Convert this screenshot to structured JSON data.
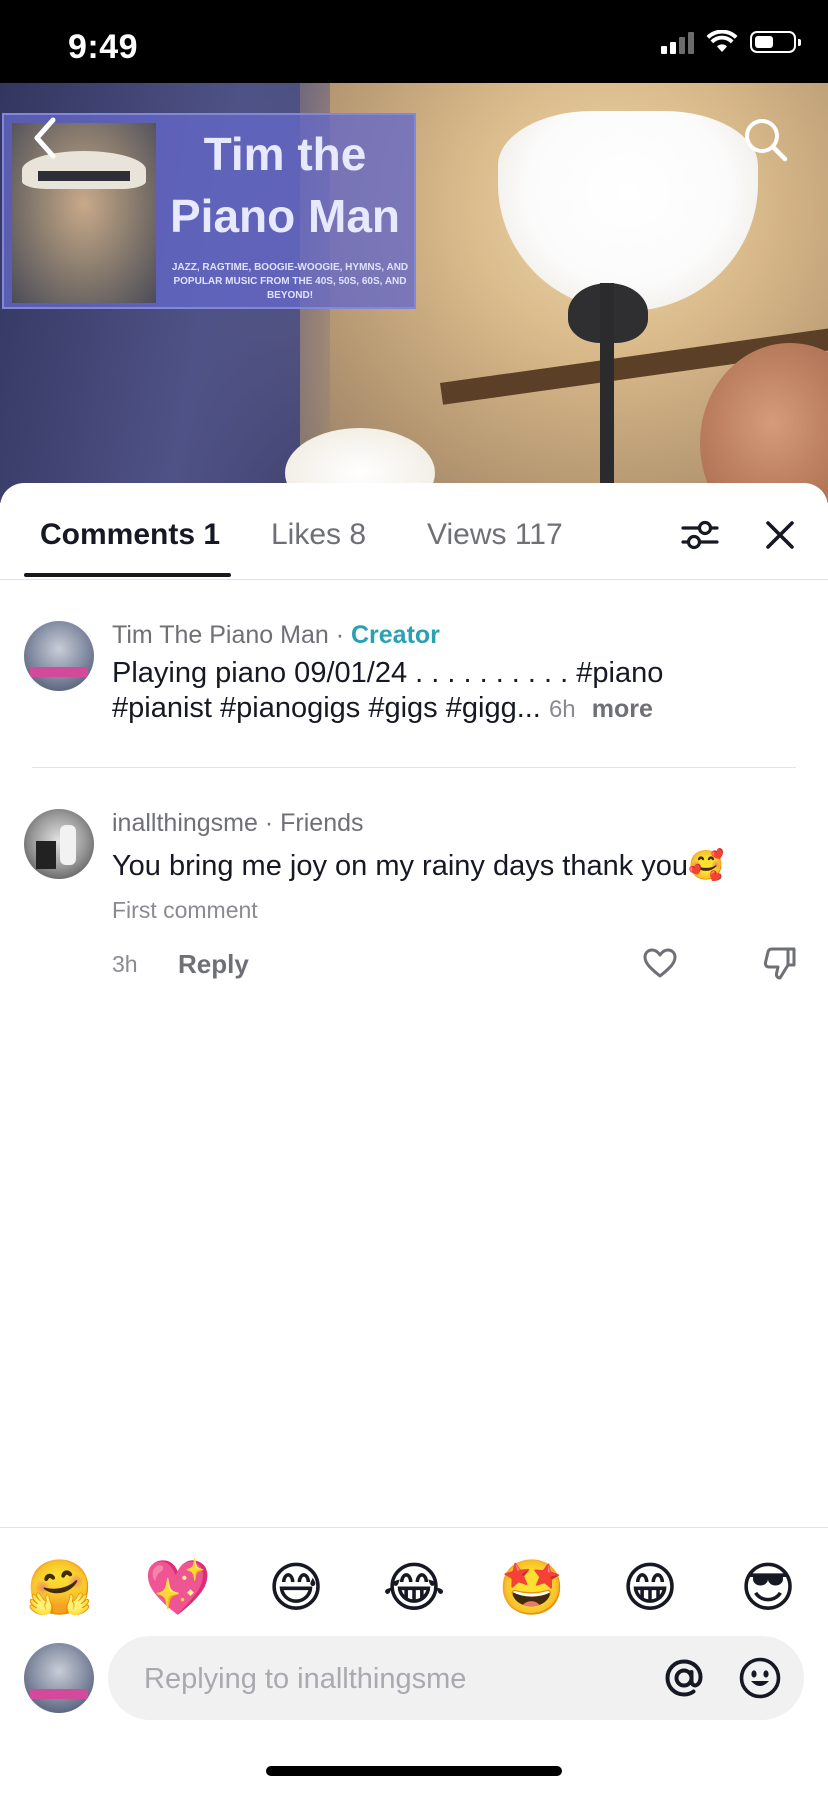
{
  "status_bar": {
    "time": "9:49"
  },
  "video": {
    "banner_title": "Tim the Piano Man",
    "banner_tagline": "JAZZ, RAGTIME, BOOGIE-WOOGIE, HYMNS, AND POPULAR MUSIC FROM THE 40S, 50S, 60S, AND BEYOND!"
  },
  "tabs": [
    {
      "label": "Comments 1",
      "active": true
    },
    {
      "label": "Likes 8",
      "active": false
    },
    {
      "label": "Views 117",
      "active": false
    }
  ],
  "post": {
    "author": "Tim The Piano Man",
    "separator": " · ",
    "role": "Creator",
    "caption": "Playing piano 09/01/24 . . . . . . . . . . #piano #pianist #pianogigs #gigs #gigg...",
    "time": "6h",
    "more": "more"
  },
  "comment": {
    "author": "inallthingsme",
    "separator": " · ",
    "relation": "Friends",
    "text": "You bring me joy on my rainy days thank you🥰",
    "badge": "First comment",
    "time": "3h",
    "reply": "Reply"
  },
  "emoji_bar": [
    "🤗",
    "💖",
    "😅",
    "😂",
    "🤩",
    "😁",
    "😎"
  ],
  "composer": {
    "placeholder": "Replying to inallthingsme"
  },
  "icons": {
    "back": "chevron-left-icon",
    "search": "search-icon",
    "filter": "sliders-icon",
    "close": "close-icon",
    "like": "heart-icon",
    "dislike": "thumbs-down-icon",
    "mention": "at-icon",
    "emoji": "smiley-icon"
  }
}
